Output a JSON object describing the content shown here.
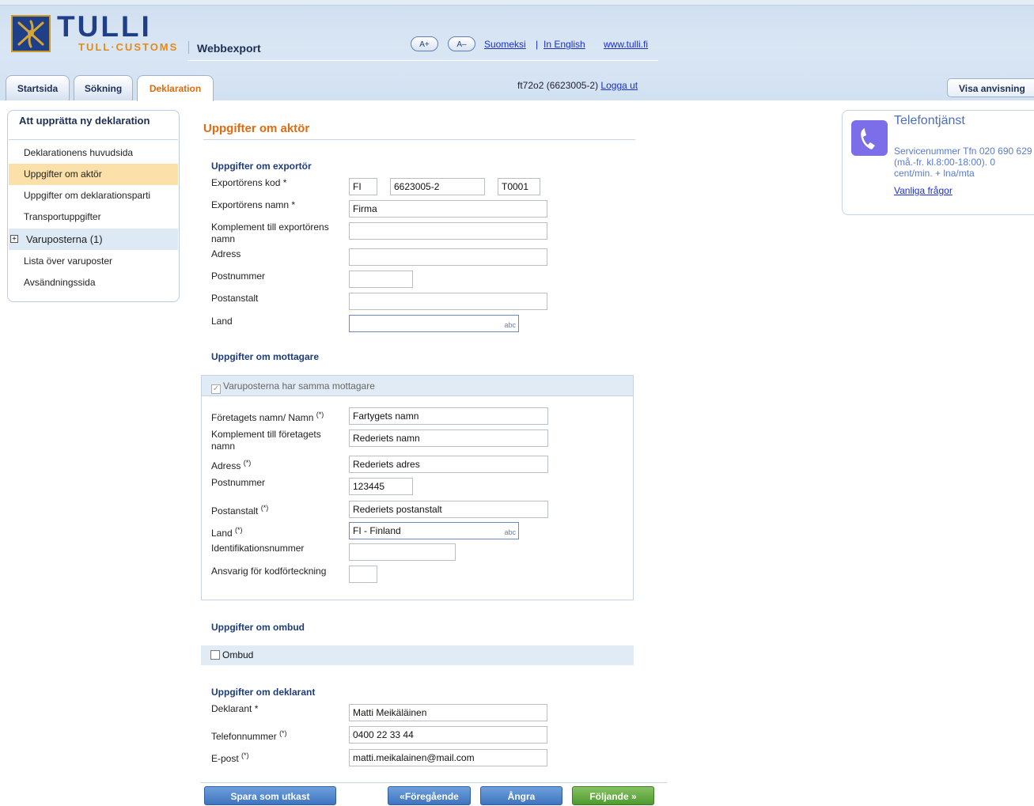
{
  "header": {
    "brand": "TULLI",
    "brand_sub": "TULL·CUSTOMS",
    "app_name": "Webbexport",
    "font_increase": "A+",
    "font_decrease": "A–",
    "lang_fi": "Suomeksi",
    "lang_en": "In English",
    "site_link": "www.tulli.fi",
    "user_id": "ft72o2 (6623005-2)",
    "logout": "Logga ut",
    "help_button": "Visa anvisning"
  },
  "tabs": [
    "Startsida",
    "Sökning",
    "Deklaration"
  ],
  "sidebar": {
    "title": "Att upprätta ny deklaration",
    "items": [
      "Deklarationens huvudsida",
      "Uppgifter om aktör",
      "Uppgifter om deklarationsparti",
      "Transportuppgifter",
      "Varuposterna (1)",
      "Lista över varuposter",
      "Avsändningssida"
    ]
  },
  "page_title": "Uppgifter om aktör",
  "exporter": {
    "heading": "Uppgifter om exportör",
    "code_label": "Exportörens kod *",
    "code_country": "FI",
    "code_number": "6623005-2",
    "code_suffix": "T0001",
    "name_label": "Exportörens namn *",
    "name_value": "Firma",
    "complement_label": "Komplement till exportörens namn",
    "complement_value": "",
    "address_label": "Adress",
    "address_value": "",
    "postcode_label": "Postnummer",
    "postcode_value": "",
    "postoffice_label": "Postanstalt",
    "postoffice_value": "",
    "country_label": "Land",
    "country_value": "",
    "code_marker": "abc"
  },
  "consignee": {
    "heading": "Uppgifter om mottagare",
    "same_consignee_label": "Varuposterna har samma mottagare",
    "same_consignee_checked": true,
    "company_label": "Företagets namn/ Namn",
    "company_value": "Fartygets namn",
    "complement_label": "Komplement till företagets namn",
    "complement_value": "Rederiets namn",
    "address_label": "Adress",
    "address_value": "Rederiets adres",
    "postcode_label": "Postnummer",
    "postcode_value": "123445",
    "postoffice_label": "Postanstalt",
    "postoffice_value": "Rederiets postanstalt",
    "country_label": "Land",
    "country_value": "FI - Finland",
    "id_label": "Identifikationsnummer",
    "id_value": "",
    "registry_label": "Ansvarig för kodförteckning",
    "registry_value": "",
    "code_marker": "abc",
    "required_mark": "(*)"
  },
  "agent": {
    "heading": "Uppgifter om ombud",
    "checkbox_label": "Ombud",
    "checked": false
  },
  "declarant": {
    "heading": "Uppgifter om deklarant",
    "name_label": "Deklarant *",
    "name_value": "Matti Meikäläinen",
    "phone_label": "Telefonnummer",
    "phone_value": "0400 22 33 44",
    "email_label": "E-post",
    "email_value": "matti.meikalainen@mail.com",
    "required_mark": "(*)"
  },
  "buttons": {
    "save_draft": "Spara som utkast",
    "previous": "«Föregående",
    "cancel": "Ångra",
    "next": "Följande »"
  },
  "info_box": {
    "title": "Telefontjänst",
    "text": "Servicenummer Tfn 020 690 629 (må.-fr. kl.8:00-18:00). 0 cent/min. + lna/mta",
    "link": "Vanliga frågor"
  },
  "colors": {
    "accent_orange": "#e06b10",
    "brand_blue": "#1f3f87",
    "link_blue": "#1a2fd0",
    "button_blue": "#3f74be",
    "button_green": "#4e9a2f"
  }
}
